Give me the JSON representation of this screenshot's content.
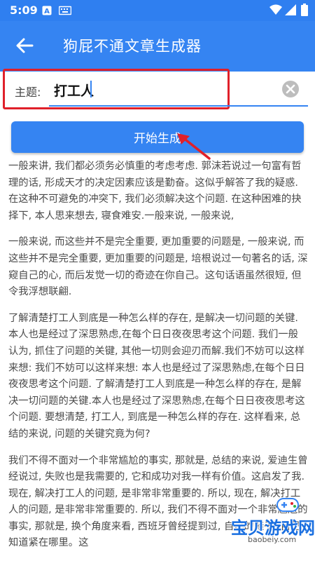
{
  "status_bar": {
    "time": "5:09",
    "icons": [
      "notification-a-icon",
      "keyboard-icon",
      "wifi-icon",
      "signal-icon",
      "battery-icon"
    ]
  },
  "app_bar": {
    "title": "狗屁不通文章生成器",
    "back_icon": "back-arrow-icon"
  },
  "topic_input": {
    "label": "主题:",
    "value": "打工人",
    "clear_icon": "clear-icon"
  },
  "generate_button": {
    "label": "开始生成"
  },
  "article": {
    "paragraphs": [
      "一般来讲, 我们都必须务必慎重的考虑考虑. 郭沫若说过一句富有哲理的话, 形成天才的决定因素应该是勤奋。这似乎解答了我的疑惑. 在这种不可避免的冲突下, 我们必须解决这个问题. 在这种困难的抉择下, 本人思来想去, 寝食难安.一般来说, 一般来说,",
      "一般来说, 而这些并不是完全重要, 更加重要的问题是, 一般来说, 而这些并不是完全重要, 更加重要的问题是, 培根说过一句著名的话, 深窥自己的心, 而后发觉一切的奇迹在你自己。这句话语虽然很短, 但令我浮想联翩.",
      "了解清楚打工人到底是一种怎么样的存在, 是解决一切问题的关键.本人也是经过了深思熟虑,在每个日日夜夜思考这个问题. 我们一般认为, 抓住了问题的关键, 其他一切则会迎刃而解.我们不妨可以这样来想: 我们不妨可以这样来想: 本人也是经过了深思熟虑,在每个日日夜夜思考这个问题. 了解清楚打工人到底是一种怎么样的存在, 是解决一切问题的关键.本人也是经过了深思熟虑,在每个日日夜夜思考这个问题. 要想清楚, 打工人, 到底是一种怎么样的存在. 这样看来, 总结的来说, 问题的关键究竟为何?",
      "我们不得不面对一个非常尴尬的事实, 那就是, 总结的来说, 爱迪生曾经说过, 失败也是我需要的, 它和成功对我一样有价值。这启发了我. 现在, 解决打工人的问题, 是非常非常重要的. 所以, 现在, 解决打工人的问题, 是非常非常重要的. 所以, 我们不得不面对一个非常尴尬的事实, 那就是, 换个角度来看, 西班牙曾经提到过, 自己的鞋子, 自己知道紧在哪里。这"
    ]
  },
  "watermark": {
    "text": "宝贝游戏网",
    "url": "baobeiy.com",
    "icon": "gamepad-icon"
  },
  "colors": {
    "primary": "#3584f2",
    "status_bar": "#2f7ff0",
    "highlight": "#e0202a",
    "text": "#4a4a4a"
  }
}
